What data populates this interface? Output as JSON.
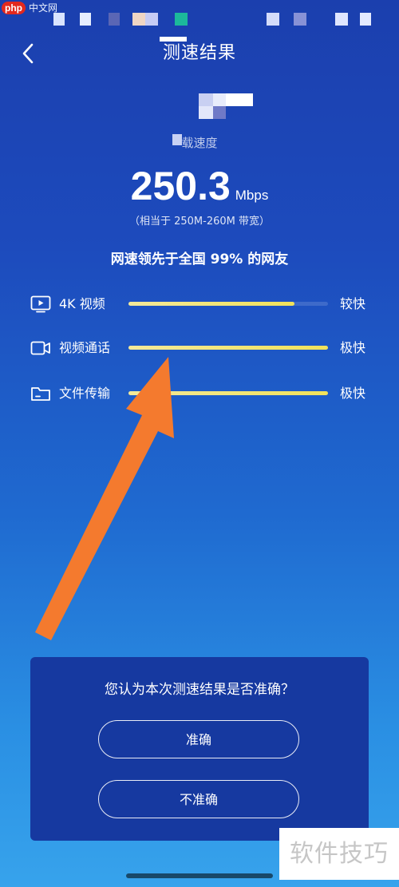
{
  "status_bar": {
    "brand_badge": "php",
    "brand_site": "中文网"
  },
  "header": {
    "title": "测速结果"
  },
  "result": {
    "speed_label": "载速度",
    "speed_value": "250.3",
    "speed_unit": "Mbps",
    "bandwidth_range": "（相当于 250M-260M 带宽）",
    "rank_text": "网速领先于全国 99% 的网友"
  },
  "metrics": [
    {
      "label": "4K 视频",
      "status": "较快",
      "level": 0.83,
      "icon": "tv-play-icon"
    },
    {
      "label": "视频通话",
      "status": "极快",
      "level": 1.0,
      "icon": "video-camera-icon"
    },
    {
      "label": "文件传输",
      "status": "极快",
      "level": 1.0,
      "icon": "folder-icon"
    }
  ],
  "feedback": {
    "question": "您认为本次测速结果是否准确？",
    "accurate_label": "准确",
    "inaccurate_label": "不准确"
  },
  "watermark": "软件技巧",
  "colors": {
    "bar_fill": "#f1e25a",
    "arrow": "#f47a2e",
    "card_bg": "#1639a0"
  }
}
